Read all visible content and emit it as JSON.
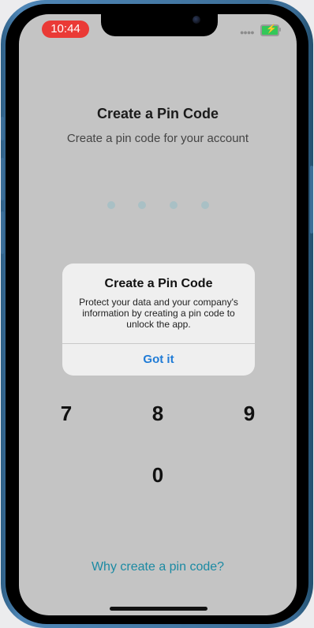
{
  "status_bar": {
    "time": "10:44",
    "signal_icon": "cellular-dots-icon",
    "battery_icon": "battery-charging-icon"
  },
  "header": {
    "title": "Create a Pin Code",
    "subtitle": "Create a pin code for your account"
  },
  "pin": {
    "length": 4,
    "filled": 0
  },
  "keypad": {
    "keys": [
      "7",
      "8",
      "9",
      "0"
    ]
  },
  "footer": {
    "help_link": "Why create a pin code?"
  },
  "alert": {
    "title": "Create a Pin Code",
    "message": "Protect your data and your company's information by creating a pin code to unlock the app.",
    "button": "Got it"
  },
  "colors": {
    "screen_bg": "#c4c4c4",
    "link": "#1b8aa3",
    "alert_button": "#1f7bd6",
    "time_pill": "#ea3a36",
    "frame": "#3c6f99"
  }
}
